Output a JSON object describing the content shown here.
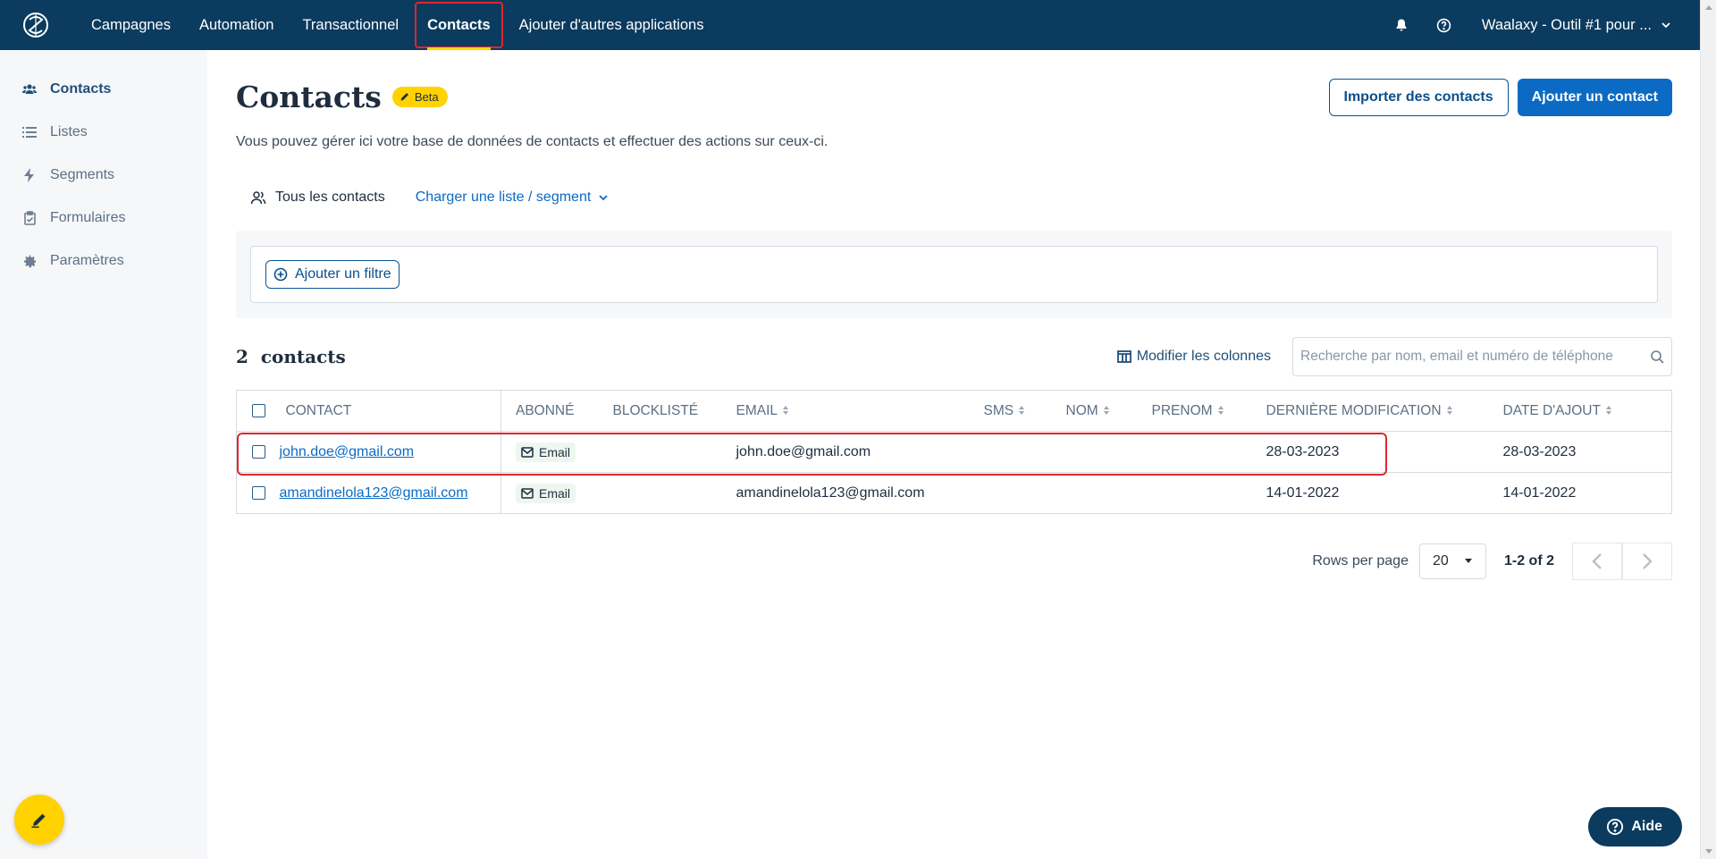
{
  "topnav": {
    "items": [
      {
        "label": "Campagnes"
      },
      {
        "label": "Automation"
      },
      {
        "label": "Transactionnel"
      },
      {
        "label": "Contacts"
      },
      {
        "label": "Ajouter d'autres applications"
      }
    ],
    "account": "Waalaxy - Outil #1 pour ..."
  },
  "sidebar": {
    "items": [
      {
        "label": "Contacts",
        "icon": "users-icon"
      },
      {
        "label": "Listes",
        "icon": "list-icon"
      },
      {
        "label": "Segments",
        "icon": "bolt-icon"
      },
      {
        "label": "Formulaires",
        "icon": "clipboard-icon"
      },
      {
        "label": "Paramètres",
        "icon": "gear-icon"
      }
    ]
  },
  "page": {
    "title": "Contacts",
    "beta": "Beta",
    "subtitle": "Vous pouvez gérer ici votre base de données de contacts et effectuer des actions sur ceux-ci.",
    "import_btn": "Importer des contacts",
    "add_btn": "Ajouter un contact",
    "tab_all": "Tous les contacts",
    "tab_load": "Charger une liste / segment",
    "add_filter": "Ajouter un filtre",
    "count_number": "2",
    "count_label": "contacts",
    "modify_columns": "Modifier les colonnes",
    "search_placeholder": "Recherche par nom, email et numéro de téléphone"
  },
  "table": {
    "columns": [
      "CONTACT",
      "ABONNÉ",
      "BLOCKLISTÉ",
      "EMAIL",
      "SMS",
      "NOM",
      "PRENOM",
      "DERNIÈRE MODIFICATION",
      "DATE D'AJOUT"
    ],
    "rows": [
      {
        "contact": "john.doe@gmail.com",
        "abonne": "Email",
        "email": "john.doe@gmail.com",
        "modified": "28-03-2023",
        "added": "28-03-2023"
      },
      {
        "contact": "amandinelola123@gmail.com",
        "abonne": "Email",
        "email": "amandinelola123@gmail.com",
        "modified": "14-01-2022",
        "added": "14-01-2022"
      }
    ]
  },
  "pager": {
    "rows_per_page_label": "Rows per page",
    "rows_per_page": "20",
    "range": "1-2 of 2"
  },
  "help": {
    "label": "Aide"
  },
  "colors": {
    "nav_bg": "#0b3b5e",
    "accent_yellow": "#ffd200",
    "primary_blue": "#0b6bc4",
    "highlight_red": "#e0262f"
  }
}
